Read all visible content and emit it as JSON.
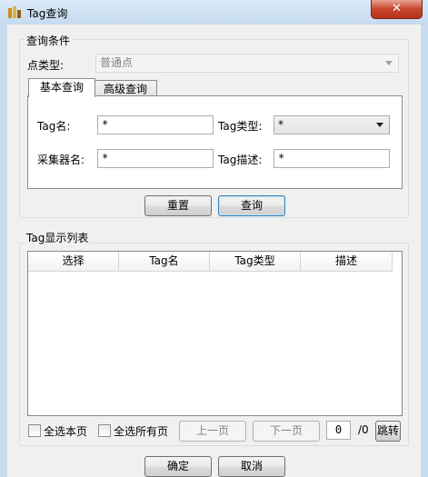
{
  "window": {
    "title": "Tag查询",
    "close_symbol": "✕"
  },
  "query_group": {
    "label": "查询条件",
    "point_type_label": "点类型:",
    "point_type_value": "普通点",
    "tabs": [
      {
        "label": "基本查询"
      },
      {
        "label": "高级查询"
      }
    ],
    "tag_name_label": "Tag名:",
    "tag_name_value": "*",
    "tag_type_label": "Tag类型:",
    "tag_type_value": "*",
    "collector_label": "采集器名:",
    "collector_value": "*",
    "tag_desc_label": "Tag描述:",
    "tag_desc_value": "*",
    "reset_label": "重置",
    "query_label": "查询"
  },
  "list_group": {
    "label": "Tag显示列表",
    "columns": [
      "选择",
      "Tag名",
      "Tag类型",
      "描述"
    ],
    "select_page_label": "全选本页",
    "select_all_label": "全选所有页",
    "prev_label": "上一页",
    "next_label": "下一页",
    "page_value": "0",
    "page_total": "/0",
    "jump_label": "跳转"
  },
  "footer": {
    "ok_label": "确定",
    "cancel_label": "取消"
  }
}
